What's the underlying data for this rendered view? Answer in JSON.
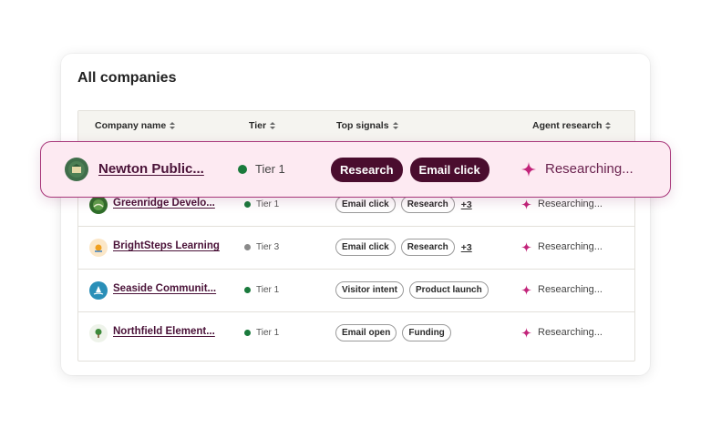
{
  "title": "All companies",
  "columns": [
    "Company name",
    "Tier",
    "Top signals",
    "Agent research"
  ],
  "highlighted": {
    "name": "Newton Public...",
    "tier": "Tier 1",
    "tier_color": "#1a7a3c",
    "signals": [
      "Research",
      "Email click"
    ],
    "agent": "Researching..."
  },
  "rows": [
    {
      "name": "Greenridge Develo...",
      "tier": "Tier 1",
      "tier_color": "#1a7a3c",
      "signals": [
        "Email click",
        "Research"
      ],
      "more": "+3",
      "agent": "Researching..."
    },
    {
      "name": "BrightSteps Learning",
      "tier": "Tier 3",
      "tier_color": "#8a8a8a",
      "signals": [
        "Email click",
        "Research"
      ],
      "more": "+3",
      "agent": "Researching..."
    },
    {
      "name": "Seaside Communit...",
      "tier": "Tier 1",
      "tier_color": "#1a7a3c",
      "signals": [
        "Visitor intent",
        "Product launch"
      ],
      "more": "",
      "agent": "Researching..."
    },
    {
      "name": "Northfield Element...",
      "tier": "Tier 1",
      "tier_color": "#1a7a3c",
      "signals": [
        "Email open",
        "Funding"
      ],
      "more": "",
      "agent": "Researching..."
    }
  ],
  "icons": {
    "sort": "sort-icon",
    "sparkle": "sparkle-icon"
  },
  "colors": {
    "accent": "#a8367a",
    "chip_dark": "#4a0d2e",
    "name_link": "#4a1238",
    "sparkle": "#c2247a"
  }
}
